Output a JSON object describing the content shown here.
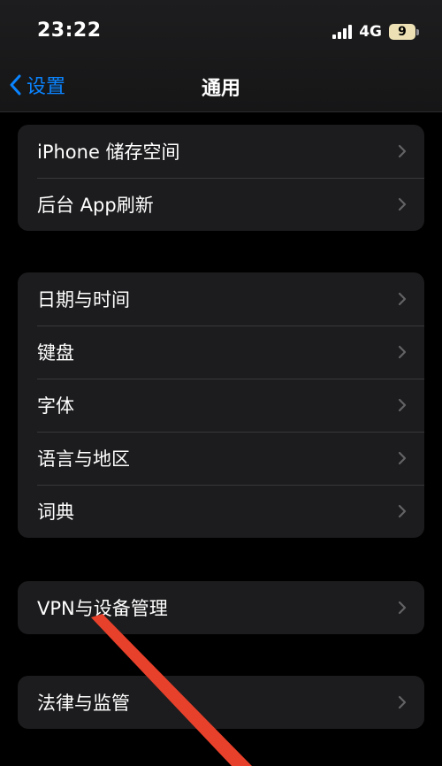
{
  "status_bar": {
    "time": "23:22",
    "network": "4G",
    "battery": "9"
  },
  "nav": {
    "back_label": "设置",
    "title": "通用"
  },
  "groups": [
    {
      "items": [
        {
          "label": "iPhone 储存空间"
        },
        {
          "label": "后台 App刷新"
        }
      ]
    },
    {
      "items": [
        {
          "label": "日期与时间"
        },
        {
          "label": "键盘"
        },
        {
          "label": "字体"
        },
        {
          "label": "语言与地区"
        },
        {
          "label": "词典"
        }
      ]
    },
    {
      "items": [
        {
          "label": "VPN与设备管理"
        }
      ]
    },
    {
      "items": [
        {
          "label": "法律与监管"
        }
      ]
    }
  ],
  "colors": {
    "accent": "#0a84ff",
    "background": "#000000",
    "cell": "#1c1c1e",
    "annotation": "#e8412b"
  },
  "icons": [
    "chevron-left-icon",
    "chevron-right-icon",
    "signal-icon",
    "battery-icon"
  ]
}
